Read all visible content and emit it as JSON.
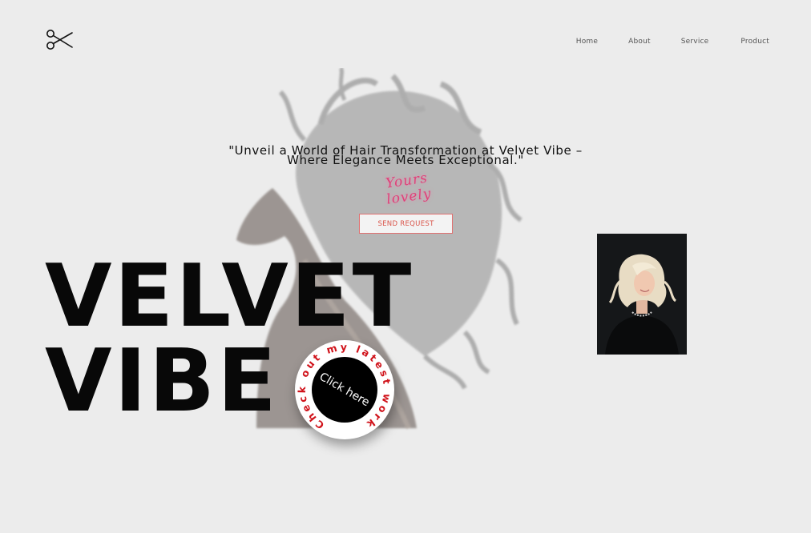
{
  "nav": {
    "items": [
      {
        "label": "Home"
      },
      {
        "label": "About"
      },
      {
        "label": "Service"
      },
      {
        "label": "Product"
      }
    ]
  },
  "hero": {
    "tagline_line1": "\"Unveil a World of Hair Transformation at Velvet Vibe –",
    "tagline_line2": "Where Elegance Meets Exceptional.\"",
    "signature": "Yours lovely",
    "send_button_label": "SEND REQUEST",
    "headline_line1": "VELVET",
    "headline_line2": "VIBE"
  },
  "badge": {
    "ring_text": "Check out my latest work",
    "center_label": "Click here"
  },
  "colors": {
    "background": "#ececec",
    "accent_red": "#d9544a",
    "signature_pink": "#e0417a",
    "badge_text_red": "#d0121a"
  }
}
